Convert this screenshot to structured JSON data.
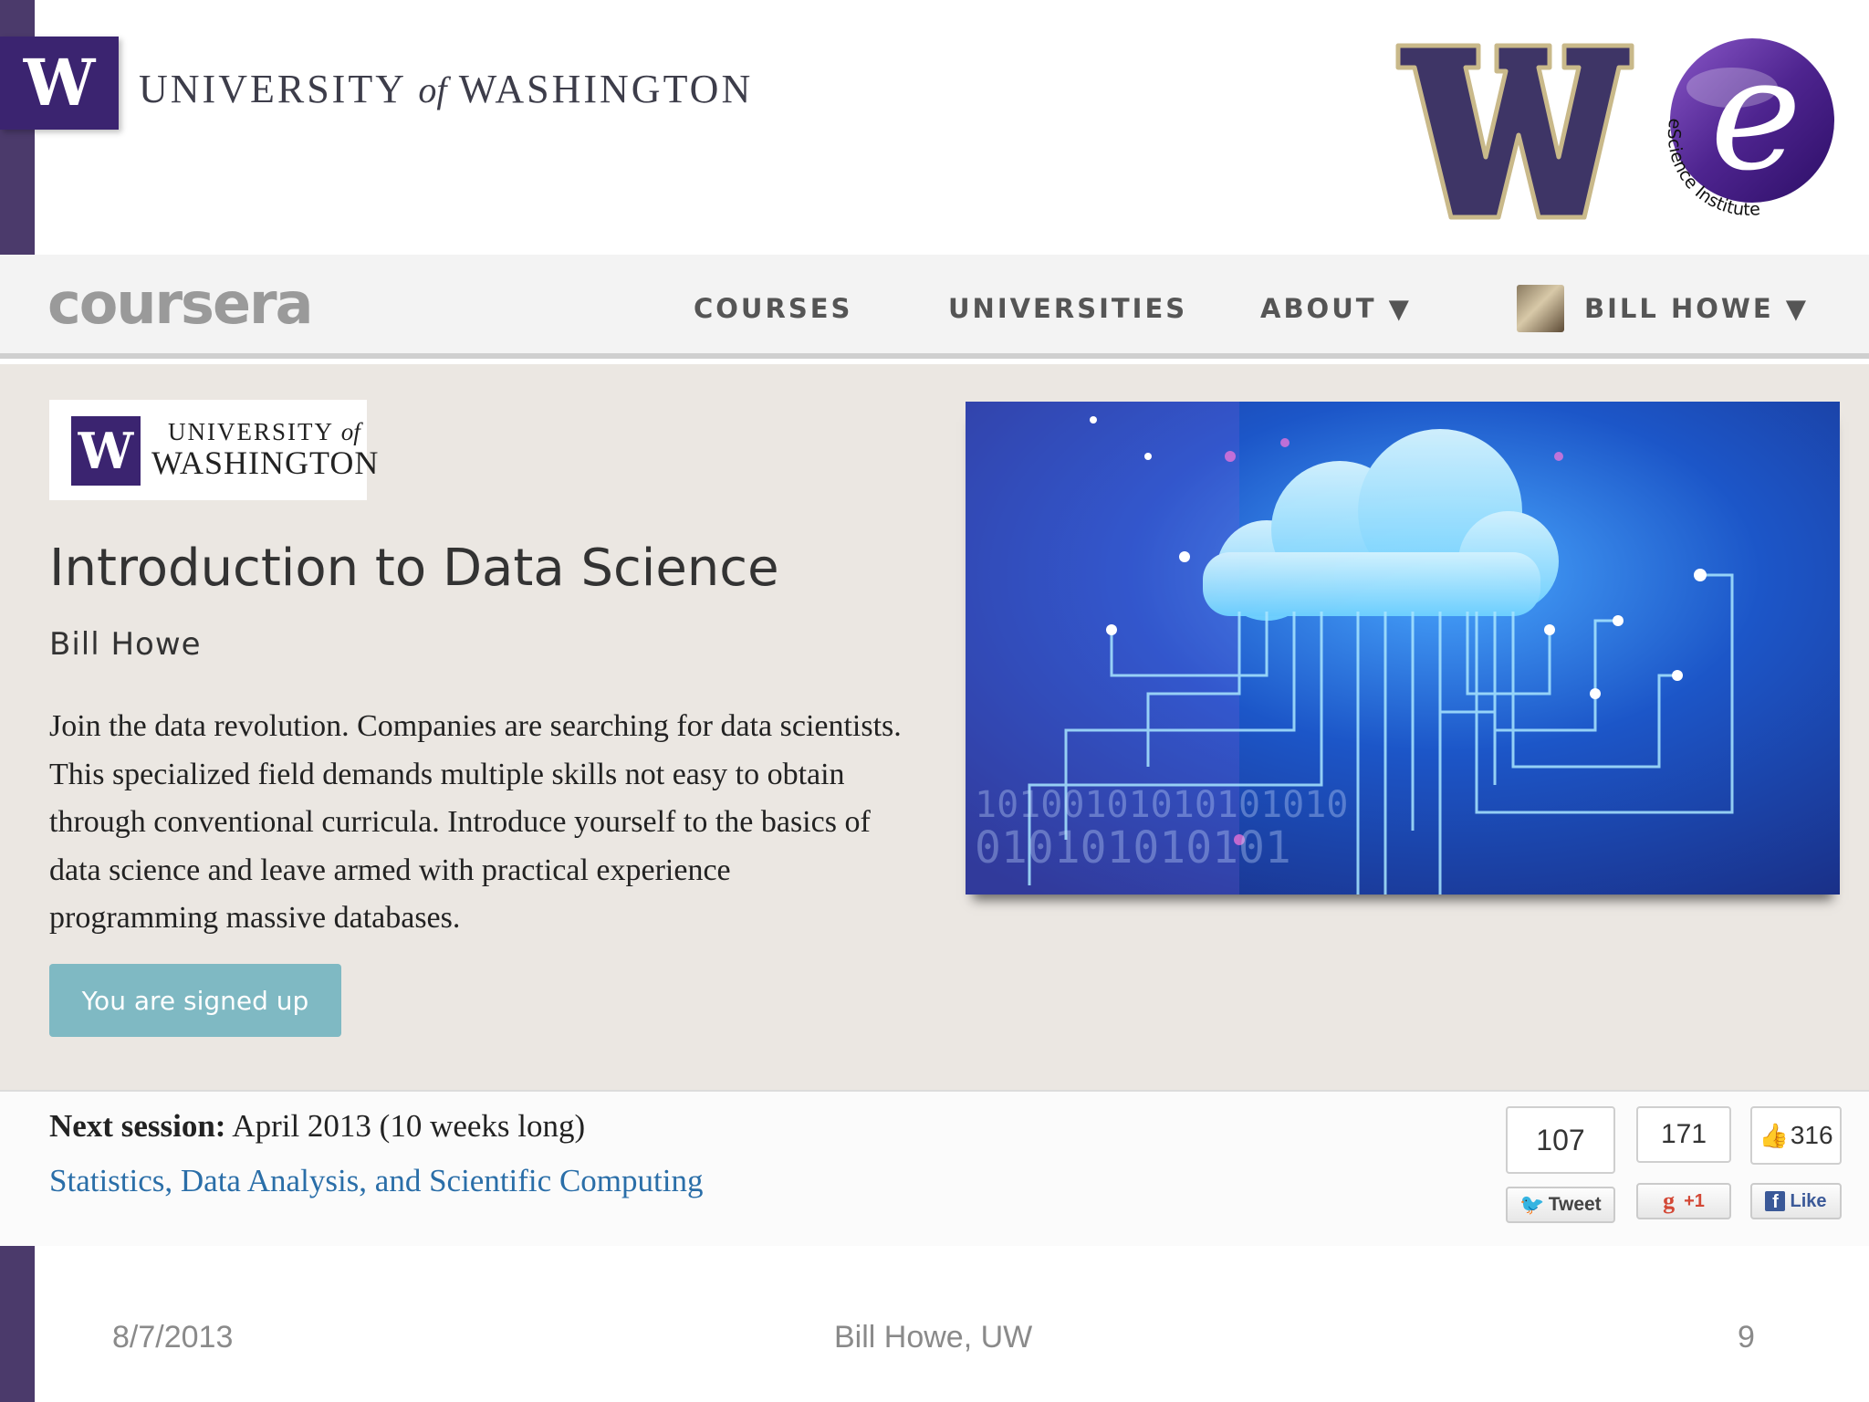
{
  "slide_header": {
    "logo_letter": "W",
    "university_word_1": "UNIVERSITY",
    "university_word_of": "of",
    "university_word_2": "WASHINGTON",
    "escience_label": "eScience Institute"
  },
  "nav": {
    "brand": "coursera",
    "items": [
      {
        "label": "COURSES"
      },
      {
        "label": "UNIVERSITIES"
      },
      {
        "label": "ABOUT ▼"
      }
    ],
    "user_name": "BILL HOWE ▼"
  },
  "course": {
    "university_logo_letter": "W",
    "university_line1_a": "UNIVERSITY",
    "university_line1_of": "of",
    "university_line2": "WASHINGTON",
    "title": "Introduction to Data Science",
    "instructor": "Bill Howe",
    "description": "Join the data revolution. Companies are searching for data scientists. This specialized field demands multiple skills not easy to obtain through conventional curricula. Introduce yourself to the basics of data science and leave armed with practical experience programming massive databases.",
    "signup_button": "You are signed up",
    "image_binary_1": "10100101010101010",
    "image_binary_2": "010101010101"
  },
  "session": {
    "label": "Next session:",
    "value": " April 2013 (10 weeks long)",
    "category": "Statistics, Data Analysis, and Scientific Computing"
  },
  "social": {
    "tweet_count": "107",
    "tweet_label": "Tweet",
    "gplus_count": "171",
    "gplus_label": "+1",
    "like_count": "316",
    "like_label": "Like"
  },
  "footer": {
    "date": "8/7/2013",
    "author": "Bill Howe, UW",
    "page": "9"
  },
  "colors": {
    "uw_purple": "#3b2470",
    "accent_bar": "#4b3a6b",
    "uw_gold": "#b7a57a",
    "signup_button": "#7fb9c3",
    "link": "#2a6ea8"
  }
}
